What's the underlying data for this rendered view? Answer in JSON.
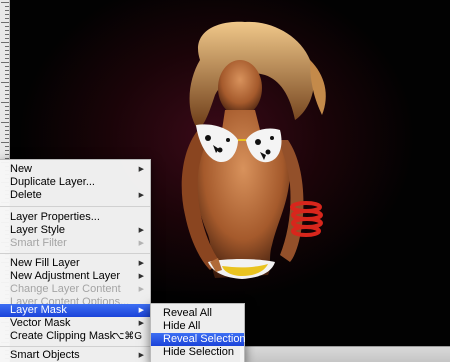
{
  "context_menu": {
    "items": [
      {
        "label": "New",
        "submenu": true
      },
      {
        "label": "Duplicate Layer...",
        "submenu": false
      },
      {
        "label": "Delete",
        "submenu": true
      },
      {
        "label": "Layer Properties...",
        "submenu": false
      },
      {
        "label": "Layer Style",
        "submenu": true
      },
      {
        "label": "Smart Filter",
        "submenu": true,
        "disabled": true
      },
      {
        "label": "New Fill Layer",
        "submenu": true
      },
      {
        "label": "New Adjustment Layer",
        "submenu": true
      },
      {
        "label": "Change Layer Content",
        "submenu": true,
        "disabled": true
      },
      {
        "label": "Layer Content Options...",
        "disabled": true
      },
      {
        "label": "Layer Mask",
        "submenu": true,
        "highlighted": true
      },
      {
        "label": "Vector Mask",
        "submenu": true
      },
      {
        "label": "Create Clipping Mask",
        "shortcut": "⌥⌘G"
      },
      {
        "label": "Smart Objects",
        "submenu": true
      }
    ]
  },
  "layer_mask_submenu": {
    "items": [
      {
        "label": "Reveal All"
      },
      {
        "label": "Hide All"
      },
      {
        "label": "Reveal Selection",
        "highlighted": true
      },
      {
        "label": "Hide Selection"
      }
    ]
  },
  "colors": {
    "menu_highlight": "#2a57e6",
    "canvas_background": "#000000",
    "glow": "#3a0a18",
    "bikini_top": "#f4f4f4",
    "bikini_bottom": "#e9c31f",
    "bracelets": "#d8261c"
  },
  "icons": {
    "submenu_arrow": "triangle-right",
    "canvas_photo": "woman-in-bikini"
  }
}
